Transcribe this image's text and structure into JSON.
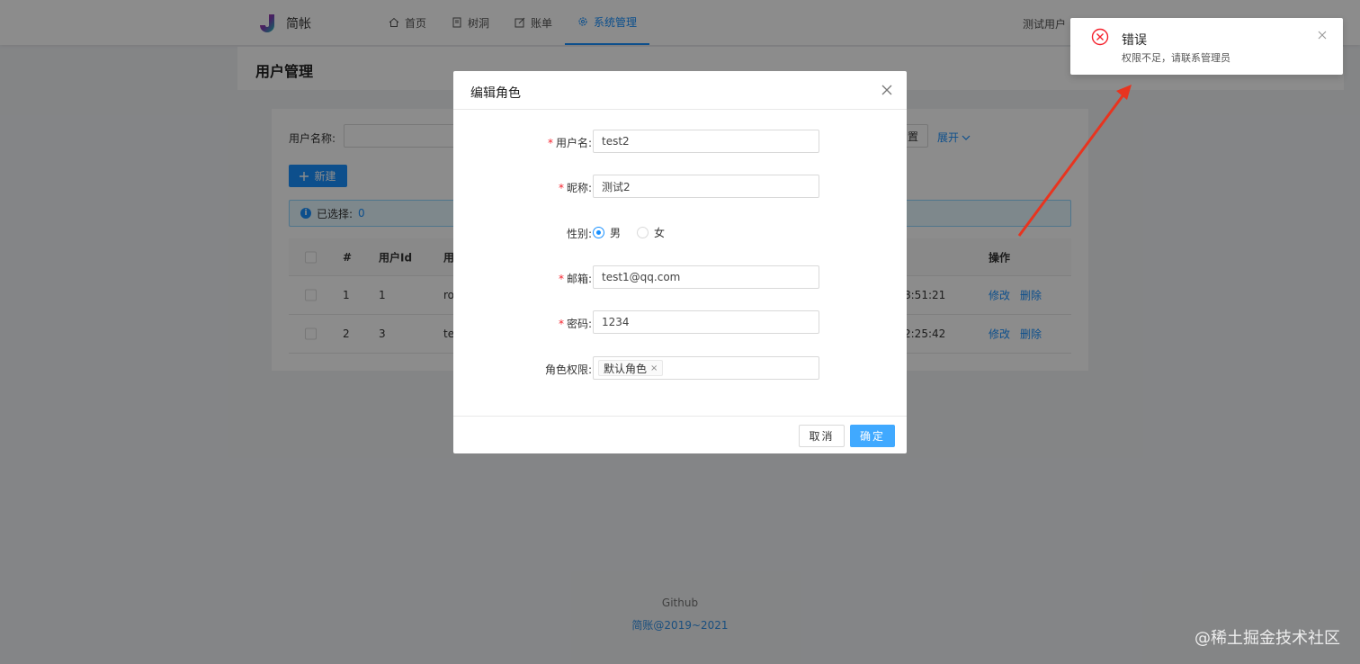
{
  "header": {
    "logo_text": "简帐",
    "nav": [
      {
        "label": "首页",
        "icon": "home-icon"
      },
      {
        "label": "树洞",
        "icon": "book-icon"
      },
      {
        "label": "账单",
        "icon": "edit-icon"
      },
      {
        "label": "系统管理",
        "icon": "gear-icon",
        "active": true
      }
    ],
    "user_name": "测试用户"
  },
  "page": {
    "title": "用户管理",
    "search_label": "用户名称:",
    "reset_label": "置",
    "expand_label": "展开",
    "new_button": "新建",
    "alert_text": "已选择:",
    "alert_count": "0"
  },
  "table": {
    "headers": [
      "#",
      "用户Id",
      "用",
      "操作"
    ],
    "rows": [
      {
        "index": "1",
        "id": "1",
        "name": "ro",
        "time": "8:51:21",
        "edit": "修改",
        "delete": "删除"
      },
      {
        "index": "2",
        "id": "3",
        "name": "te",
        "time": "2:25:42",
        "edit": "修改",
        "delete": "删除"
      }
    ]
  },
  "modal": {
    "title": "编辑角色",
    "fields": {
      "username": {
        "label": "用户名:",
        "value": "test2"
      },
      "nickname": {
        "label": "昵称:",
        "value": "测试2"
      },
      "gender": {
        "label": "性别:",
        "options": [
          "男",
          "女"
        ],
        "selected": "男"
      },
      "email": {
        "label": "邮箱:",
        "value": "test1@qq.com"
      },
      "password": {
        "label": "密码:",
        "value": "1234"
      },
      "role": {
        "label": "角色权限:",
        "tags": [
          "默认角色"
        ]
      }
    },
    "cancel_label": "取消",
    "ok_label": "确定"
  },
  "notification": {
    "title": "错误",
    "description": "权限不足，请联系管理员"
  },
  "footer": {
    "link": "Github",
    "copyright": "简账@2019~2021"
  },
  "watermark": "@稀土掘金技术社区",
  "colors": {
    "primary": "#1890ff",
    "error": "#f5222d",
    "arrow": "#e8341f"
  }
}
